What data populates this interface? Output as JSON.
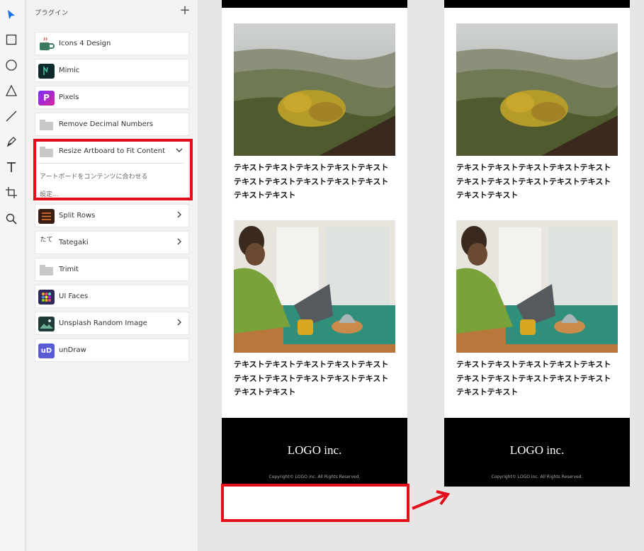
{
  "toolbar": {
    "tools": [
      "select-icon",
      "rectangle-icon",
      "ellipse-icon",
      "polygon-icon",
      "line-icon",
      "pen-icon",
      "text-icon",
      "artboard-icon",
      "zoom-icon"
    ]
  },
  "panel": {
    "title": "プラグイン",
    "add_label": "+",
    "plugins": [
      {
        "name": "Icons 4 Design",
        "icon": "coffee-cup-icon"
      },
      {
        "name": "Mimic",
        "icon": "mimic-icon"
      },
      {
        "name": "Pixels",
        "icon": "pixels-icon",
        "badge": "P"
      },
      {
        "name": "Remove Decimal Numbers",
        "icon": "folder-icon"
      },
      {
        "name": "Resize Artboard to Fit Content",
        "icon": "folder-icon",
        "expanded": true,
        "sub_action": "アートボードをコンテンツに合わせる",
        "settings": "設定..."
      },
      {
        "name": "Split Rows",
        "icon": "split-rows-icon"
      },
      {
        "name": "Tategaki",
        "icon": "tategaki-icon",
        "badge": "たて"
      },
      {
        "name": "Trimit",
        "icon": "folder-icon"
      },
      {
        "name": "UI Faces",
        "icon": "ui-faces-icon"
      },
      {
        "name": "Unsplash Random Image",
        "icon": "unsplash-icon"
      },
      {
        "name": "unDraw",
        "icon": "undraw-icon",
        "badge": "uD"
      }
    ]
  },
  "artboards": [
    {
      "caption1": "テキストテキストテキストテキストテキストテキストテキストテキストテキストテキストテキストテキスト",
      "caption2": "テキストテキストテキストテキストテキストテキストテキストテキストテキストテキストテキストテキスト",
      "logo": "LOGO inc.",
      "copyright": "Copyright© LOGO inc. All Rights Reserved."
    },
    {
      "caption1": "テキストテキストテキストテキストテキストテキストテキストテキストテキストテキストテキストテキスト",
      "caption2": "テキストテキストテキストテキストテキストテキストテキストテキストテキストテキストテキストテキスト",
      "logo": "LOGO inc.",
      "copyright": "Copyright© LOGO inc. All Rights Reserved."
    }
  ],
  "colors": {
    "highlight": "#e20e1a",
    "accent": "#1473e6"
  }
}
